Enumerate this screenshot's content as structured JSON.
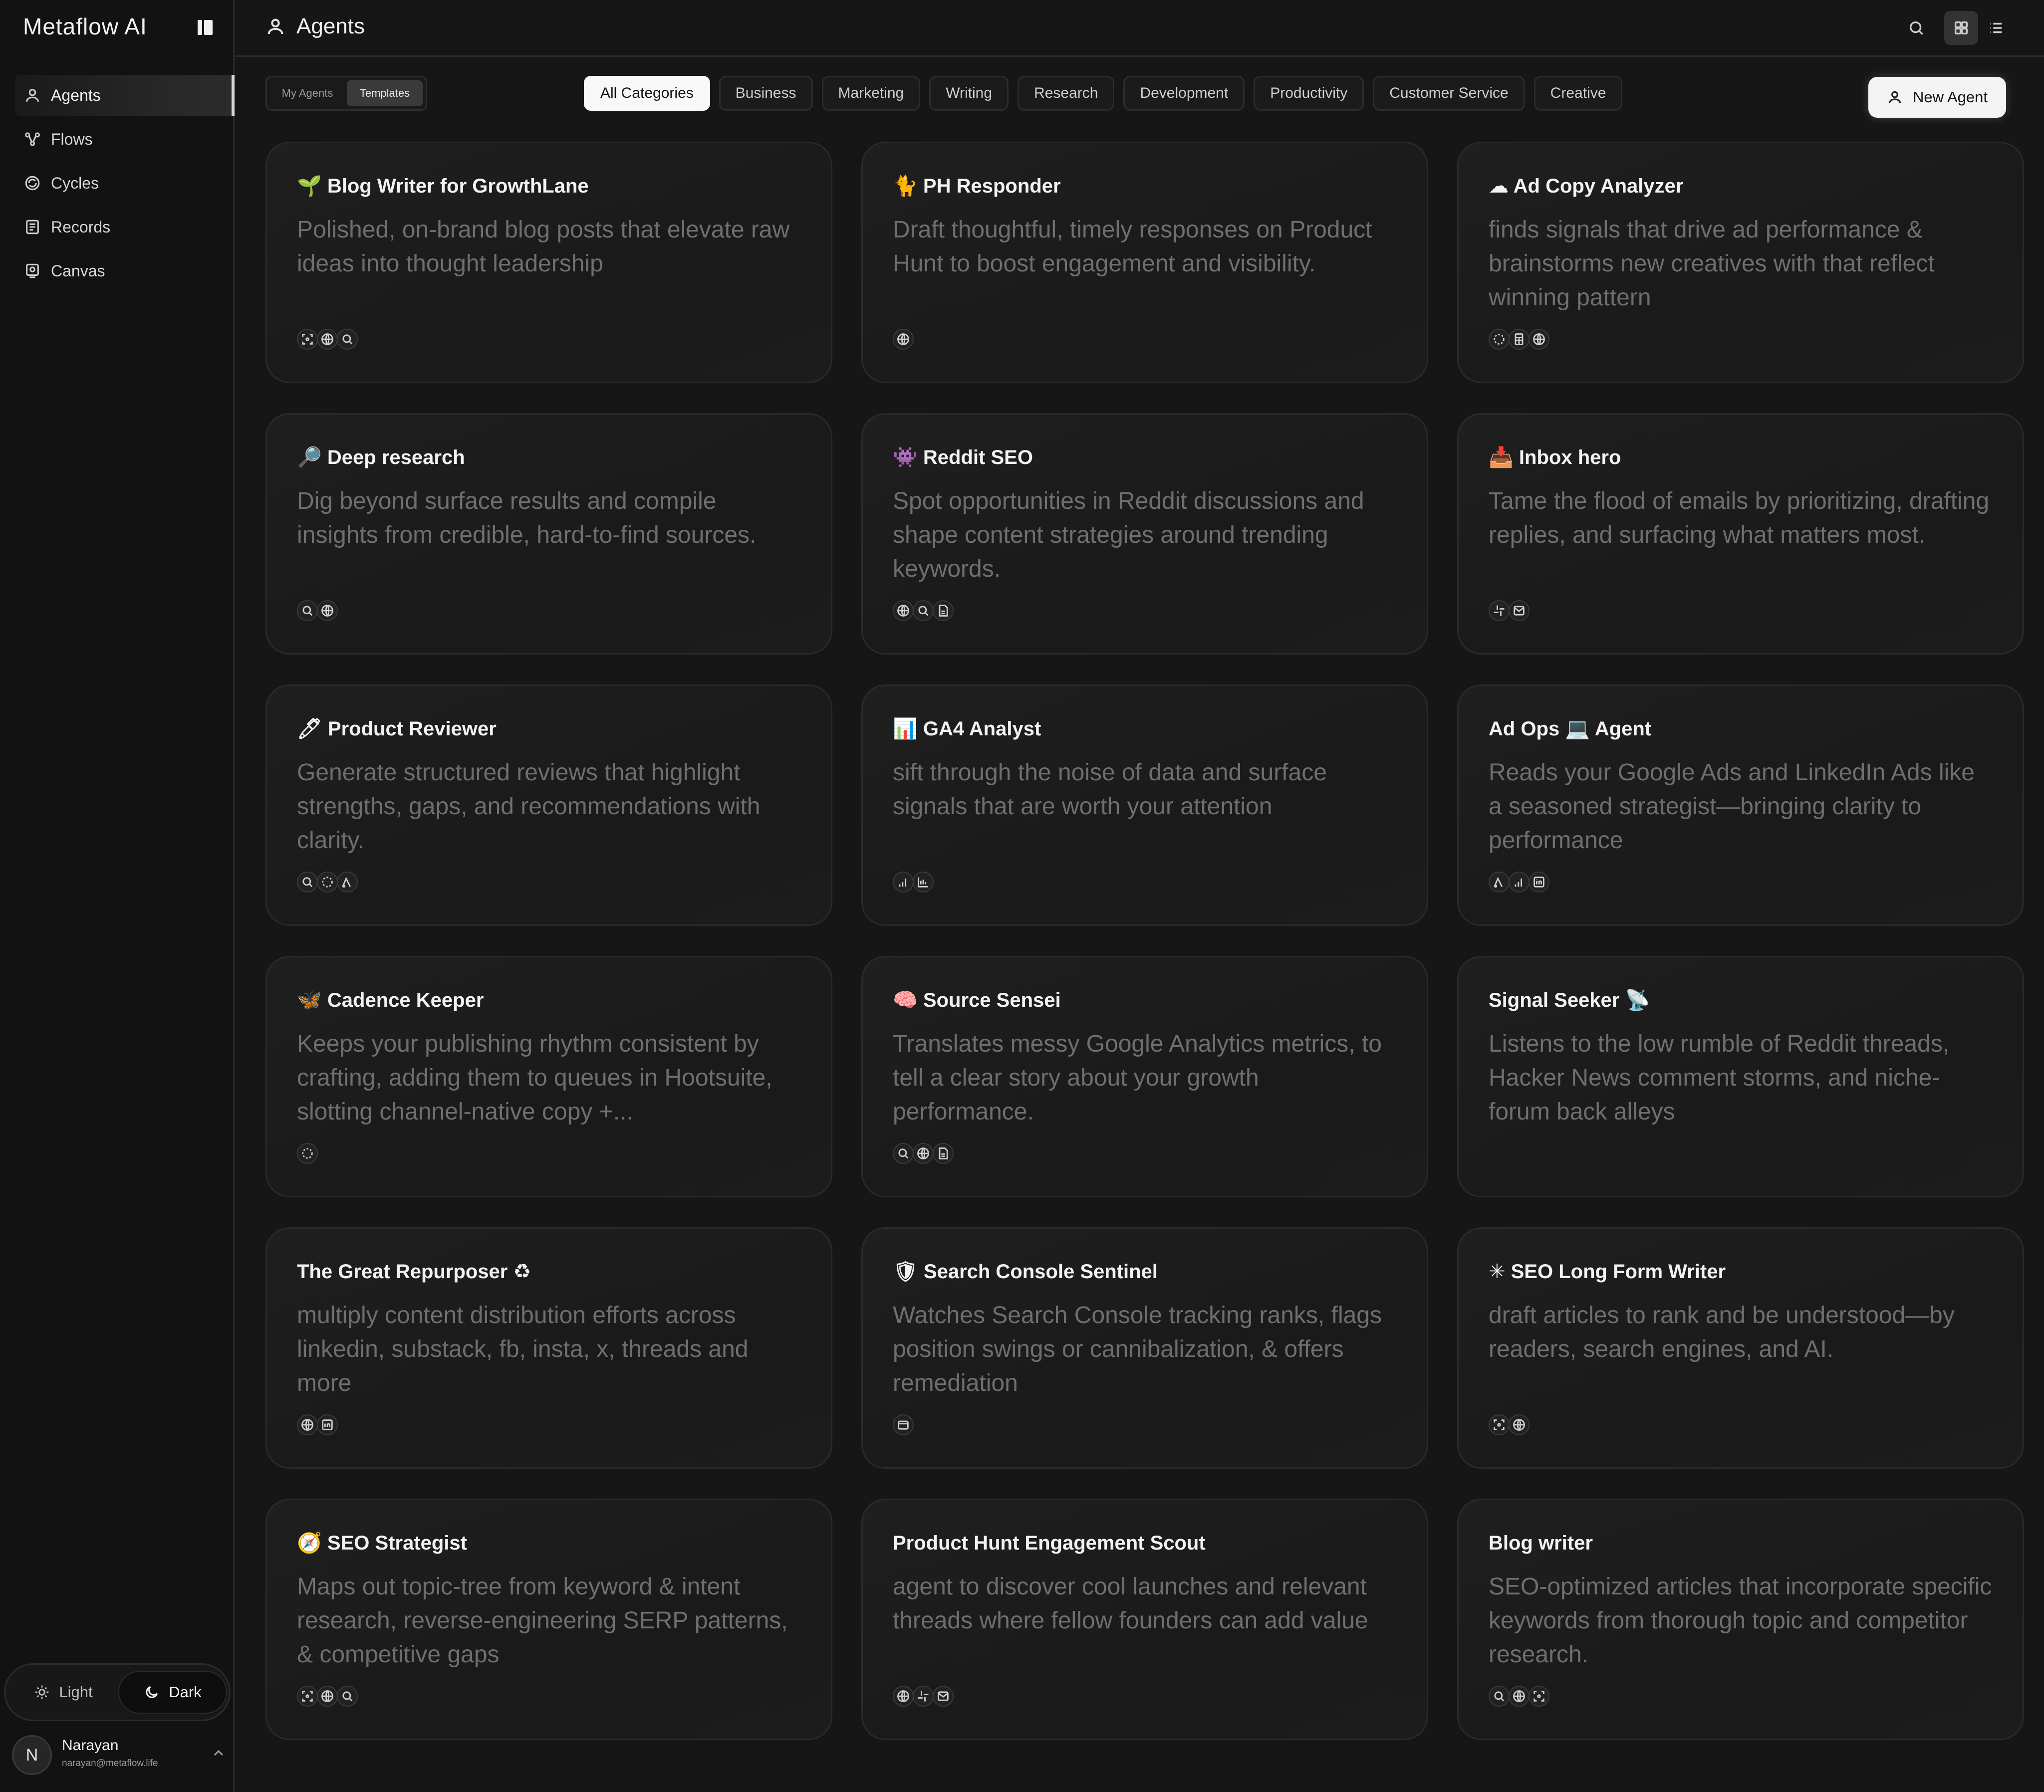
{
  "app": {
    "brand": "Metaflow AI",
    "page_title": "Agents"
  },
  "sidebar": {
    "items": [
      {
        "label": "Agents",
        "icon": "agent-icon",
        "active": true
      },
      {
        "label": "Flows",
        "icon": "flows-icon",
        "active": false
      },
      {
        "label": "Cycles",
        "icon": "cycles-icon",
        "active": false
      },
      {
        "label": "Records",
        "icon": "records-icon",
        "active": false
      },
      {
        "label": "Canvas",
        "icon": "canvas-icon",
        "active": false
      }
    ],
    "theme": {
      "light_label": "Light",
      "dark_label": "Dark",
      "selected": "Dark"
    },
    "user": {
      "initial": "N",
      "name": "Narayan",
      "email": "narayan@metaflow.life"
    }
  },
  "filters": {
    "segment": {
      "my_agents": "My Agents",
      "templates": "Templates",
      "selected": "Templates"
    },
    "categories": [
      "All Categories",
      "Business",
      "Marketing",
      "Writing",
      "Research",
      "Development",
      "Productivity",
      "Customer Service",
      "Creative"
    ],
    "selected_category": "All Categories",
    "new_agent_label": "New Agent"
  },
  "cards": [
    {
      "title": "🌱 Blog Writer for GrowthLane",
      "desc": "Polished, on-brand blog posts that elevate raw ideas into thought leadership",
      "tools": [
        "scan-icon",
        "globe-icon",
        "search-icon"
      ]
    },
    {
      "title": "🐈 PH Responder",
      "desc": "Draft thoughtful, timely responses on Product Hunt to boost engagement and visibility.",
      "tools": [
        "globe-icon"
      ]
    },
    {
      "title": "☁ Ad Copy Analyzer",
      "desc": "finds signals that drive ad performance & brainstorms new creatives with that reflect winning pattern",
      "tools": [
        "dashed-circle-icon",
        "sheet-icon",
        "globe-icon"
      ]
    },
    {
      "title": "🔎 Deep research",
      "desc": "Dig beyond surface results and compile insights from credible, hard-to-find sources.",
      "tools": [
        "search-icon",
        "globe-icon"
      ]
    },
    {
      "title": "👾 Reddit SEO",
      "desc": "Spot opportunities in Reddit discussions and shape content strategies around trending keywords.",
      "tools": [
        "globe-icon",
        "search-icon",
        "doc-icon"
      ]
    },
    {
      "title": "📥 Inbox hero",
      "desc": "Tame the flood of emails by prioritizing, drafting replies, and surfacing what matters most.",
      "tools": [
        "slack-icon",
        "mail-icon"
      ]
    },
    {
      "title": "🖊 Product Reviewer",
      "desc": "Generate structured reviews that highlight strengths, gaps, and recommendations with clarity.",
      "tools": [
        "search-icon",
        "dashed-circle-icon",
        "ads-icon"
      ]
    },
    {
      "title": "📊 GA4 Analyst",
      "desc": "sift through the noise of data and surface signals that are worth your attention",
      "tools": [
        "analytics-icon",
        "chart-icon"
      ]
    },
    {
      "title": "Ad Ops 💻 Agent",
      "desc": "Reads your Google Ads and LinkedIn Ads like a seasoned strategist—bringing clarity to performance",
      "tools": [
        "ads-icon",
        "analytics-icon",
        "linkedin-icon"
      ]
    },
    {
      "title": "🦋 Cadence Keeper",
      "desc": "Keeps your publishing rhythm consistent by crafting, adding them to queues in Hootsuite, slotting channel-native copy +...",
      "tools": [
        "dashed-circle-icon"
      ]
    },
    {
      "title": "🧠 Source Sensei",
      "desc": "Translates messy Google Analytics metrics, to tell a clear story about your growth performance.",
      "tools": [
        "search-icon",
        "globe-icon",
        "doc-icon"
      ]
    },
    {
      "title": "Signal Seeker 📡",
      "desc": "Listens to the low rumble of Reddit threads, Hacker News comment storms, and niche-forum back alleys",
      "tools": []
    },
    {
      "title": "The Great Repurposer ♻",
      "desc": "multiply content distribution efforts across linkedin, substack, fb, insta, x, threads and more",
      "tools": [
        "globe-icon",
        "linkedin-icon"
      ]
    },
    {
      "title": "🛡 Search Console Sentinel",
      "desc": "Watches Search Console tracking ranks, flags position swings or cannibalization, & offers remediation",
      "tools": [
        "console-icon"
      ]
    },
    {
      "title": "✳ SEO Long Form Writer",
      "desc": "draft articles to rank and be understood—by readers, search engines, and AI.",
      "tools": [
        "scan-icon",
        "globe-icon"
      ]
    },
    {
      "title": "🧭 SEO Strategist",
      "desc": "Maps out topic-tree from keyword & intent research, reverse-engineering SERP patterns, & competitive gaps",
      "tools": [
        "scan-icon",
        "globe-icon",
        "search-icon"
      ]
    },
    {
      "title": "Product Hunt Engagement Scout",
      "desc": "agent to discover cool launches and relevant threads where fellow founders can add value",
      "tools": [
        "globe-icon",
        "slack-icon",
        "mail-icon"
      ]
    },
    {
      "title": "Blog writer",
      "desc": "SEO-optimized articles that incorporate specific keywords from thorough topic and competitor research.",
      "tools": [
        "search-icon",
        "globe-icon",
        "scan-icon"
      ]
    }
  ],
  "colors": {
    "background": "#161616",
    "sidebar": "#121212",
    "card": "#1d1d1d",
    "muted_text": "#6f6f6f",
    "accent": "#f4f4f4"
  }
}
